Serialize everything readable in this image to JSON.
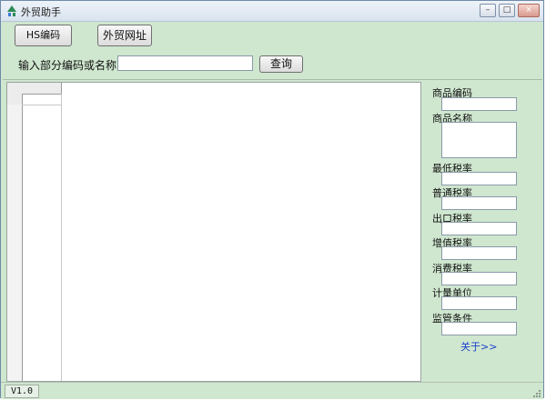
{
  "window": {
    "title": "外贸助手",
    "controls": {
      "minimize": "–",
      "maximize": "□",
      "close": "×"
    }
  },
  "tabs": [
    {
      "label": "HS编码"
    },
    {
      "label": "外贸网址"
    }
  ],
  "search": {
    "label": "输入部分编码或名称：",
    "value": "",
    "placeholder": "",
    "button": "查询"
  },
  "details": {
    "fields": [
      {
        "label": "商品编码"
      },
      {
        "label": "商品名称"
      },
      {
        "label": "最低税率"
      },
      {
        "label": "普通税率"
      },
      {
        "label": "出口税率"
      },
      {
        "label": "增值税率"
      },
      {
        "label": "消费税率"
      },
      {
        "label": "计量单位"
      },
      {
        "label": "监管条件"
      }
    ],
    "about_link": "关于>>"
  },
  "status": {
    "version": "V1.0"
  },
  "icons": {
    "app": "app-logo-icon",
    "resize": "resize-grip-icon"
  }
}
